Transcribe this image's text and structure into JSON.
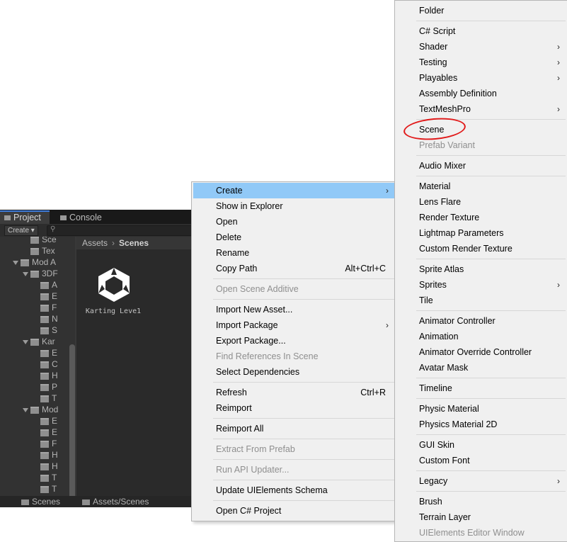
{
  "unity_window": {
    "tabs": {
      "project": "Project",
      "console": "Console"
    },
    "toolbar": {
      "create_label": "Create ▾",
      "search_icon": "search-icon"
    },
    "tree": [
      {
        "label": "Sce",
        "indent": 3,
        "expanded": false
      },
      {
        "label": "Tex",
        "indent": 3,
        "expanded": false
      },
      {
        "label": "Mod A",
        "indent": 2,
        "expanded": true
      },
      {
        "label": "3DF",
        "indent": 3,
        "expanded": true
      },
      {
        "label": "A",
        "indent": 4,
        "expanded": false
      },
      {
        "label": "E",
        "indent": 4,
        "expanded": false
      },
      {
        "label": "F",
        "indent": 4,
        "expanded": false
      },
      {
        "label": "N",
        "indent": 4,
        "expanded": false
      },
      {
        "label": "S",
        "indent": 4,
        "expanded": false
      },
      {
        "label": "Kar",
        "indent": 3,
        "expanded": true
      },
      {
        "label": "E",
        "indent": 4,
        "expanded": false
      },
      {
        "label": "C",
        "indent": 4,
        "expanded": false
      },
      {
        "label": "H",
        "indent": 4,
        "expanded": false
      },
      {
        "label": "P",
        "indent": 4,
        "expanded": false
      },
      {
        "label": "T",
        "indent": 4,
        "expanded": false
      },
      {
        "label": "Mod",
        "indent": 3,
        "expanded": true
      },
      {
        "label": "E",
        "indent": 4,
        "expanded": false
      },
      {
        "label": "E",
        "indent": 4,
        "expanded": false
      },
      {
        "label": "F",
        "indent": 4,
        "expanded": false
      },
      {
        "label": "H",
        "indent": 4,
        "expanded": false
      },
      {
        "label": "H",
        "indent": 4,
        "expanded": false
      },
      {
        "label": "T",
        "indent": 4,
        "expanded": false
      },
      {
        "label": "T",
        "indent": 4,
        "expanded": false
      }
    ],
    "breadcrumb": {
      "root": "Assets",
      "current": "Scenes"
    },
    "scene_asset": {
      "label": "Karting Leve1",
      "icon": "unity-logo-icon"
    },
    "bottom": {
      "left": "Scenes",
      "path": "Assets/Scenes"
    }
  },
  "context_menu": {
    "highlight_color": "#91c9f7",
    "items": [
      {
        "label": "Create",
        "submenu": true,
        "highlighted": true
      },
      {
        "label": "Show in Explorer"
      },
      {
        "label": "Open"
      },
      {
        "label": "Delete"
      },
      {
        "label": "Rename"
      },
      {
        "label": "Copy Path",
        "shortcut": "Alt+Ctrl+C"
      },
      {
        "separator": true
      },
      {
        "label": "Open Scene Additive",
        "disabled": true
      },
      {
        "separator": true
      },
      {
        "label": "Import New Asset..."
      },
      {
        "label": "Import Package",
        "submenu": true
      },
      {
        "label": "Export Package..."
      },
      {
        "label": "Find References In Scene",
        "disabled": true
      },
      {
        "label": "Select Dependencies"
      },
      {
        "separator": true
      },
      {
        "label": "Refresh",
        "shortcut": "Ctrl+R"
      },
      {
        "label": "Reimport"
      },
      {
        "separator": true
      },
      {
        "label": "Reimport All"
      },
      {
        "separator": true
      },
      {
        "label": "Extract From Prefab",
        "disabled": true
      },
      {
        "separator": true
      },
      {
        "label": "Run API Updater...",
        "disabled": true
      },
      {
        "separator": true
      },
      {
        "label": "Update UIElements Schema"
      },
      {
        "separator": true
      },
      {
        "label": "Open C# Project"
      }
    ]
  },
  "create_menu": {
    "annotation_color": "#e11919",
    "items": [
      {
        "label": "Folder"
      },
      {
        "separator": true
      },
      {
        "label": "C# Script"
      },
      {
        "label": "Shader",
        "submenu": true
      },
      {
        "label": "Testing",
        "submenu": true
      },
      {
        "label": "Playables",
        "submenu": true
      },
      {
        "label": "Assembly Definition"
      },
      {
        "label": "TextMeshPro",
        "submenu": true
      },
      {
        "separator": true
      },
      {
        "label": "Scene",
        "circled": true
      },
      {
        "label": "Prefab Variant",
        "disabled": true
      },
      {
        "separator": true
      },
      {
        "label": "Audio Mixer"
      },
      {
        "separator": true
      },
      {
        "label": "Material"
      },
      {
        "label": "Lens Flare"
      },
      {
        "label": "Render Texture"
      },
      {
        "label": "Lightmap Parameters"
      },
      {
        "label": "Custom Render Texture"
      },
      {
        "separator": true
      },
      {
        "label": "Sprite Atlas"
      },
      {
        "label": "Sprites",
        "submenu": true
      },
      {
        "label": "Tile"
      },
      {
        "separator": true
      },
      {
        "label": "Animator Controller"
      },
      {
        "label": "Animation"
      },
      {
        "label": "Animator Override Controller"
      },
      {
        "label": "Avatar Mask"
      },
      {
        "separator": true
      },
      {
        "label": "Timeline"
      },
      {
        "separator": true
      },
      {
        "label": "Physic Material"
      },
      {
        "label": "Physics Material 2D"
      },
      {
        "separator": true
      },
      {
        "label": "GUI Skin"
      },
      {
        "label": "Custom Font"
      },
      {
        "separator": true
      },
      {
        "label": "Legacy",
        "submenu": true
      },
      {
        "separator": true
      },
      {
        "label": "Brush"
      },
      {
        "label": "Terrain Layer"
      },
      {
        "label": "UIElements Editor Window",
        "disabled": true
      }
    ]
  }
}
